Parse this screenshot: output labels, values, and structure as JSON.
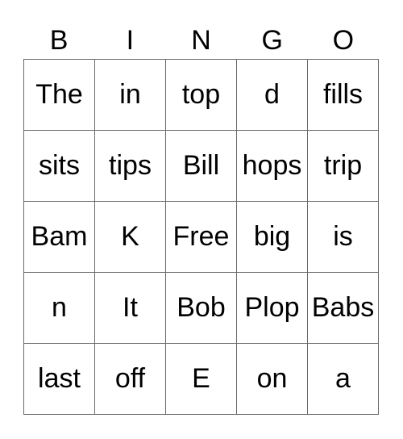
{
  "header": [
    "B",
    "I",
    "N",
    "G",
    "O"
  ],
  "rows": [
    [
      "The",
      "in",
      "top",
      "d",
      "fills"
    ],
    [
      "sits",
      "tips",
      "Bill",
      "hops",
      "trip"
    ],
    [
      "Bam",
      "K",
      "Free",
      "big",
      "is"
    ],
    [
      "n",
      "It",
      "Bob",
      "Plop",
      "Babs"
    ],
    [
      "last",
      "off",
      "E",
      "on",
      "a"
    ]
  ]
}
